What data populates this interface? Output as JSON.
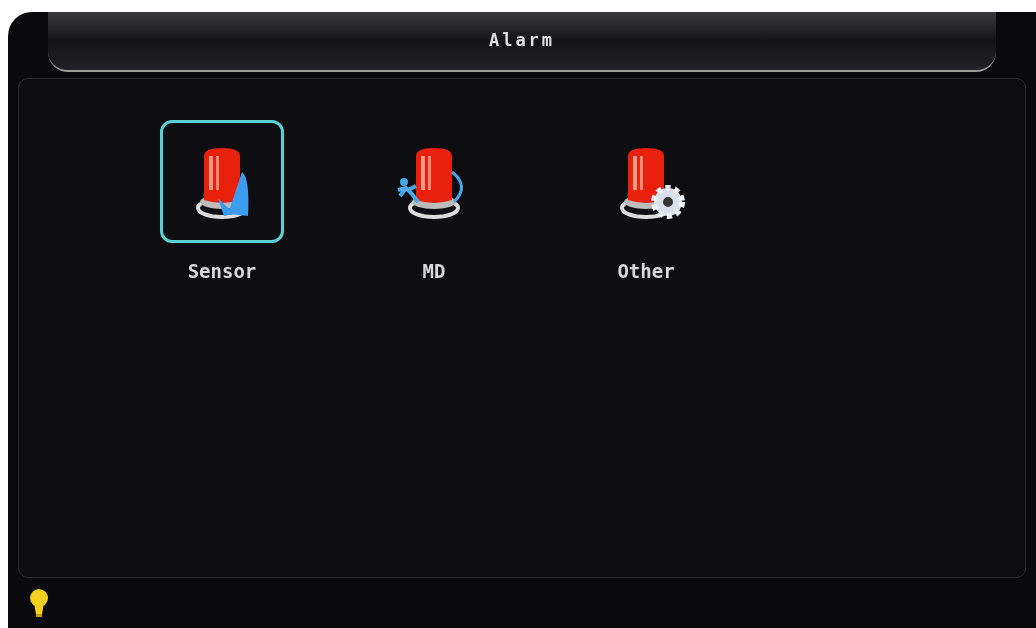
{
  "window": {
    "title": "Alarm"
  },
  "items": [
    {
      "label": "Sensor",
      "kind": "sensor",
      "selected": true
    },
    {
      "label": "MD",
      "kind": "motion",
      "selected": false
    },
    {
      "label": "Other",
      "kind": "settings",
      "selected": false
    }
  ]
}
